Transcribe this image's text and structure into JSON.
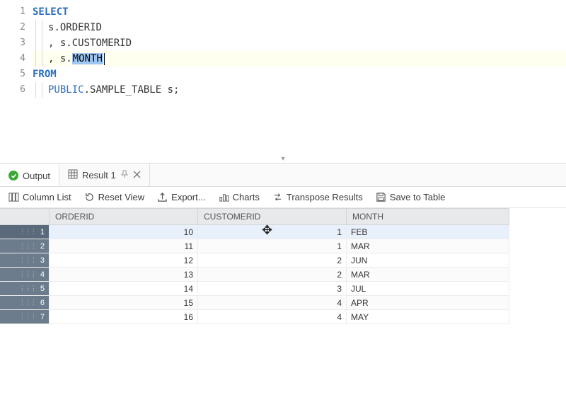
{
  "editor": {
    "lines": [
      {
        "n": "1",
        "tokens": [
          {
            "t": "SELECT",
            "c": "kw"
          }
        ]
      },
      {
        "n": "2",
        "tokens": [
          {
            "t": "s",
            "c": "plain"
          },
          {
            "t": ".",
            "c": "plain"
          },
          {
            "t": "ORDERID",
            "c": "plain"
          }
        ],
        "indent": 2
      },
      {
        "n": "3",
        "tokens": [
          {
            "t": ", s",
            "c": "plain"
          },
          {
            "t": ".",
            "c": "plain"
          },
          {
            "t": "CUSTOMERID",
            "c": "plain"
          }
        ],
        "indent": 2
      },
      {
        "n": "4",
        "tokens": [
          {
            "t": ", s",
            "c": "plain"
          },
          {
            "t": ".",
            "c": "plain"
          },
          {
            "t": "MONTH",
            "c": "hl"
          }
        ],
        "indent": 2,
        "current": true,
        "caret": true
      },
      {
        "n": "5",
        "tokens": [
          {
            "t": "FROM",
            "c": "kw"
          }
        ]
      },
      {
        "n": "6",
        "tokens": [
          {
            "t": "PUBLIC",
            "c": "schema"
          },
          {
            "t": ".",
            "c": "plain"
          },
          {
            "t": "SAMPLE_TABLE s;",
            "c": "plain"
          }
        ],
        "indent": 2
      }
    ]
  },
  "tabs": {
    "output_label": "Output",
    "result_label": "Result 1"
  },
  "toolbar": {
    "column_list": "Column List",
    "reset_view": "Reset View",
    "export": "Export...",
    "charts": "Charts",
    "transpose": "Transpose Results",
    "save_table": "Save to Table"
  },
  "grid": {
    "headers": [
      "ORDERID",
      "CUSTOMERID",
      "MONTH"
    ],
    "rows": [
      {
        "n": "1",
        "ORDERID": "10",
        "CUSTOMERID": "1",
        "MONTH": "FEB",
        "selected": true
      },
      {
        "n": "2",
        "ORDERID": "11",
        "CUSTOMERID": "1",
        "MONTH": "MAR"
      },
      {
        "n": "3",
        "ORDERID": "12",
        "CUSTOMERID": "2",
        "MONTH": "JUN"
      },
      {
        "n": "4",
        "ORDERID": "13",
        "CUSTOMERID": "2",
        "MONTH": "MAR"
      },
      {
        "n": "5",
        "ORDERID": "14",
        "CUSTOMERID": "3",
        "MONTH": "JUL"
      },
      {
        "n": "6",
        "ORDERID": "15",
        "CUSTOMERID": "4",
        "MONTH": "APR"
      },
      {
        "n": "7",
        "ORDERID": "16",
        "CUSTOMERID": "4",
        "MONTH": "MAY"
      }
    ]
  }
}
